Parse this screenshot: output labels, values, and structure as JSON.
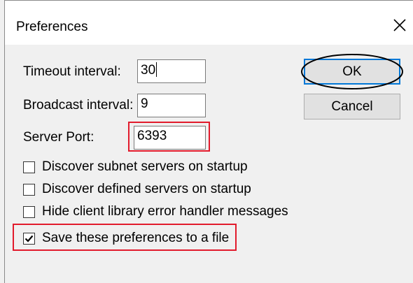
{
  "window": {
    "title": "Preferences",
    "close_icon": "close-icon"
  },
  "fields": {
    "timeout": {
      "label": "Timeout interval:",
      "value": "30"
    },
    "broadcast": {
      "label": "Broadcast interval:",
      "value": "9"
    },
    "server_port": {
      "label": "Server Port:",
      "value": "6393"
    }
  },
  "buttons": {
    "ok": "OK",
    "cancel": "Cancel"
  },
  "checkboxes": [
    {
      "label": "Discover subnet servers on startup",
      "checked": false
    },
    {
      "label": "Discover defined servers on startup",
      "checked": false
    },
    {
      "label": "Hide client library error handler messages",
      "checked": false
    },
    {
      "label": "Save these preferences to a file",
      "checked": true
    }
  ],
  "colors": {
    "annotation_red": "#e21b2c",
    "focus_blue": "#0078d7"
  }
}
